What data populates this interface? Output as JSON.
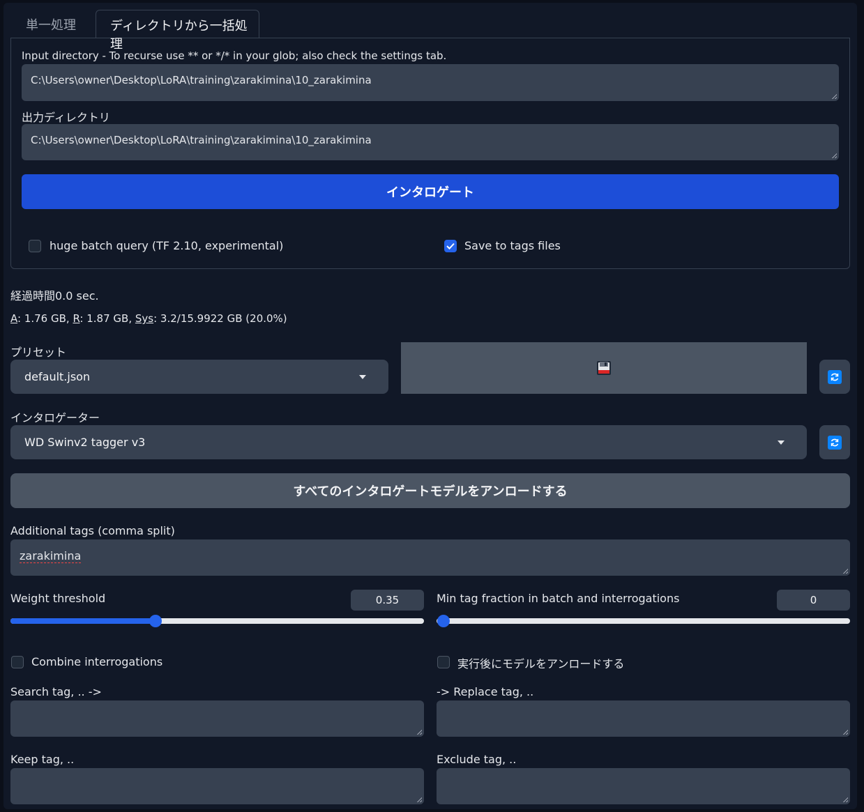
{
  "tabs": {
    "single": "単一処理",
    "batch": "ディレクトリから一括処理"
  },
  "batch": {
    "input_dir_label": "Input directory - To recurse use ** or */* in your glob; also check the settings tab.",
    "input_dir_value": "C:\\Users\\owner\\Desktop\\LoRA\\training\\zarakimina\\10_zarakimina",
    "output_dir_label": "出力ディレクトリ",
    "output_dir_value": "C:\\Users\\owner\\Desktop\\LoRA\\training\\zarakimina\\10_zarakimina",
    "interrogate_button": "インタロゲート",
    "huge_batch_label": "huge batch query (TF 2.10, experimental)",
    "huge_batch_checked": false,
    "save_tags_label": "Save to tags files",
    "save_tags_checked": true
  },
  "status": {
    "elapsed": "経過時間0.0 sec.",
    "mem_a_key": "A",
    "mem_a_value": ": 1.76 GB, ",
    "mem_r_key": "R",
    "mem_r_value": ": 1.87 GB, ",
    "mem_sys_key": "Sys",
    "mem_sys_value": ": 3.2/15.9922 GB (20.0%)"
  },
  "preset": {
    "label": "プリセット",
    "value": "default.json",
    "save_icon": "floppy-disk-icon",
    "refresh_icon": "refresh-icon"
  },
  "interrogator": {
    "label": "インタロゲーター",
    "value": "WD Swinv2 tagger v3",
    "refresh_icon": "refresh-icon"
  },
  "unload_all_button": "すべてのインタロゲートモデルをアンロードする",
  "additional_tags": {
    "label": "Additional tags (comma split)",
    "value": "zarakimina"
  },
  "weight_threshold": {
    "label": "Weight threshold",
    "value": "0.35",
    "fraction": 0.35
  },
  "min_tag_fraction": {
    "label": "Min tag fraction in batch and interrogations",
    "value": "0",
    "fraction": 0
  },
  "combine_interrogations": {
    "label": "Combine interrogations",
    "checked": false
  },
  "unload_after_run": {
    "label": "実行後にモデルをアンロードする",
    "checked": false
  },
  "search_tag": {
    "label": "Search tag, .. ->",
    "value": ""
  },
  "replace_tag": {
    "label": "-> Replace tag, ..",
    "value": ""
  },
  "keep_tag": {
    "label": "Keep tag, ..",
    "value": ""
  },
  "exclude_tag": {
    "label": "Exclude tag, ..",
    "value": ""
  },
  "colors": {
    "primary": "#1d4ed8",
    "background": "#0b0f19",
    "panel": "#111827",
    "input": "#374151",
    "slider": "#2563eb"
  }
}
